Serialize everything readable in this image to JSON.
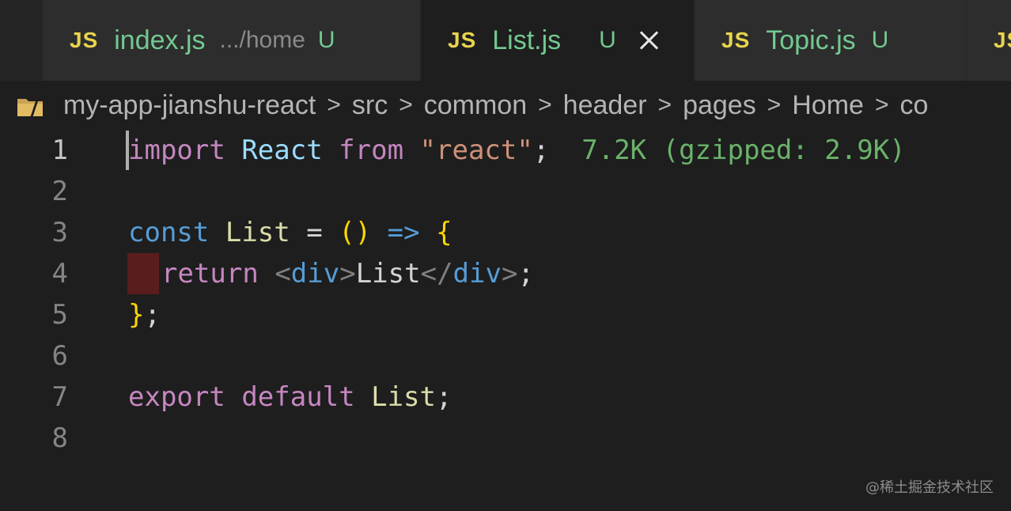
{
  "tabs": [
    {
      "icon": "JS",
      "name": "index.js",
      "path": ".../home",
      "status": "U",
      "active": false
    },
    {
      "icon": "JS",
      "name": "List.js",
      "path": "",
      "status": "U",
      "active": true
    },
    {
      "icon": "JS",
      "name": "Topic.js",
      "path": "",
      "status": "U",
      "active": false
    },
    {
      "icon": "JS"
    }
  ],
  "breadcrumb": {
    "items": [
      "my-app-jianshu-react",
      "src",
      "common",
      "header",
      "pages",
      "Home",
      "co"
    ],
    "separator": ">"
  },
  "editor": {
    "line_numbers": [
      "1",
      "2",
      "3",
      "4",
      "5",
      "6",
      "7",
      "8"
    ],
    "current_line": "1",
    "line1": {
      "import_kw": "import",
      "react_ident": "React",
      "from_kw": "from",
      "module_str": "\"react\"",
      "semicolon": ";",
      "size_hint": "7.2K (gzipped: 2.9K)"
    },
    "line3": {
      "const_kw": "const",
      "name": "List",
      "equals": "=",
      "parens": "()",
      "arrow": "=>",
      "open_brace": "{"
    },
    "line4": {
      "return_kw": "return",
      "open_lt": "<",
      "open_tag": "div",
      "open_gt": ">",
      "text": "List",
      "close_lt": "</",
      "close_tag": "div",
      "close_gt": ">",
      "semicolon": ";"
    },
    "line5": {
      "close_brace": "}",
      "semicolon": ";"
    },
    "line7": {
      "export_kw": "export",
      "default_kw": "default",
      "name": "List",
      "semicolon": ";"
    }
  },
  "watermark": "@稀土掘金技术社区",
  "colors": {
    "js_icon": "#e8d44d",
    "untracked": "#73c991",
    "keyword_purple": "#c586c0",
    "keyword_blue": "#569cd6",
    "string": "#ce9178",
    "size_hint": "#6ab26a"
  }
}
